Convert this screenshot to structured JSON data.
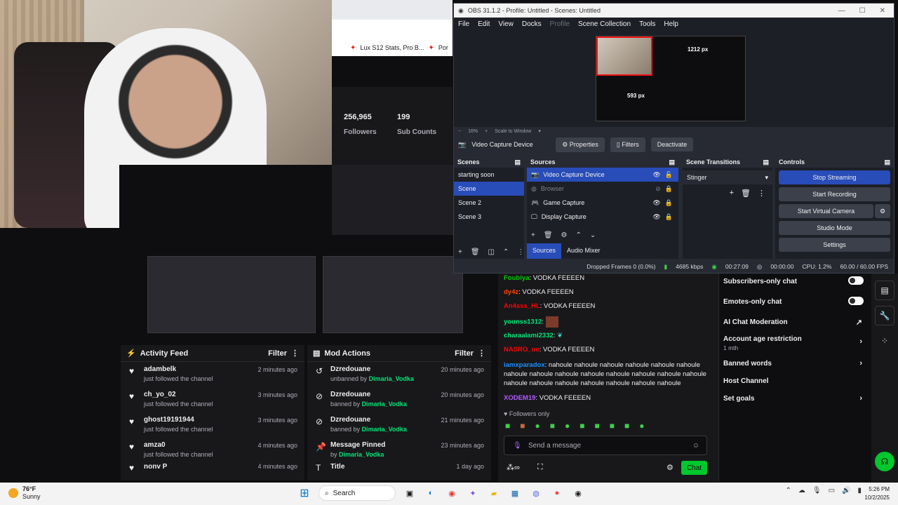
{
  "browser": {
    "bookmarks": [
      {
        "label": "Lux S12 Stats, Pro B..."
      },
      {
        "label": "Por"
      }
    ]
  },
  "stream_stats": {
    "followers_value": "256,965",
    "followers_label": "Followers",
    "subs_value": "199",
    "subs_label": "Sub Counts"
  },
  "obs": {
    "title": "OBS 31.1.2 - Profile: Untitled - Scenes: Untitled",
    "menu": [
      "File",
      "Edit",
      "View",
      "Docks",
      "Profile",
      "Scene Collection",
      "Tools",
      "Help"
    ],
    "preview_width_label": "1212 px",
    "preview_height_label": "593 px",
    "zoom": "16%",
    "scale_mode": "Scale to Window",
    "selected_source": "Video Capture Device",
    "properties_label": "Properties",
    "filters_label": "Filters",
    "deactivate_label": "Deactivate",
    "scenes_title": "Scenes",
    "scenes": [
      "starting soon",
      "Scene",
      "Scene 2",
      "Scene 3"
    ],
    "sources_title": "Sources",
    "sources": [
      "Video Capture Device",
      "Browser",
      "Game Capture",
      "Display Capture"
    ],
    "tab_sources": "Sources",
    "tab_audio_mixer": "Audio Mixer",
    "transitions_title": "Scene Transitions",
    "transition": "Stinger",
    "controls_title": "Controls",
    "controls": [
      "Stop Streaming",
      "Start Recording",
      "Start Virtual Camera",
      "Studio Mode",
      "Settings"
    ],
    "status": {
      "dropped": "Dropped Frames 0 (0.0%)",
      "bitrate": "4685 kbps",
      "live_time": "00:27:09",
      "rec_time": "00:00:00",
      "cpu": "CPU: 1.2%",
      "fps": "60.00 / 60.00 FPS"
    }
  },
  "activity_feed": {
    "title": "Activity Feed",
    "filter": "Filter",
    "items": [
      {
        "name": "adambelk",
        "sub": "just followed the channel",
        "time": "2 minutes ago"
      },
      {
        "name": "ch_yo_02",
        "sub": "just followed the channel",
        "time": "3 minutes ago"
      },
      {
        "name": "ghost19191944",
        "sub": "just followed the channel",
        "time": "3 minutes ago"
      },
      {
        "name": "amza0",
        "sub": "just followed the channel",
        "time": "4 minutes ago"
      },
      {
        "name": "nonv P",
        "sub": "",
        "time": "4 minutes ago"
      }
    ]
  },
  "mod_actions": {
    "title": "Mod Actions",
    "filter": "Filter",
    "items": [
      {
        "name": "Dzredouane",
        "action": "unbanned by",
        "by": "Dimaria_Vodka",
        "time": "20 minutes ago"
      },
      {
        "name": "Dzredouane",
        "action": "banned by",
        "by": "Dimaria_Vodka",
        "time": "20 minutes ago"
      },
      {
        "name": "Dzredouane",
        "action": "banned by",
        "by": "Dimaria_Vodka",
        "time": "21 minutes ago"
      },
      {
        "name": "Message Pinned",
        "action": "by",
        "by": "Dimaria_Vodka",
        "time": "23 minutes ago"
      },
      {
        "name": "Title",
        "action": "",
        "by": "",
        "time": "1 day ago"
      }
    ]
  },
  "chat": {
    "messages": [
      {
        "user": "Foubiya",
        "color": "#00c800",
        "text": "VODKA FEEEEN"
      },
      {
        "user": "dy4z",
        "color": "#ff4500",
        "text": "VODKA FEEEEN"
      },
      {
        "user": "An4sss_HL",
        "color": "#ff0000",
        "text": "VODKA FEEEEN"
      },
      {
        "user": "younss1312",
        "color": "#00e676",
        "text": ""
      },
      {
        "user": "charaalami2332",
        "color": "#00e676",
        "text": ""
      },
      {
        "user": "NASRO_ue",
        "color": "#ff0000",
        "text": "VODKA FEEEEN"
      },
      {
        "user": "iamxparadox",
        "color": "#1e90ff",
        "text": "nahoule nahoule nahoule nahoule nahoule nahoule nahoule nahoule nahoule nahoule nahoule nahoule nahoule nahoule nahoule nahoule nahoule nahoule nahoule nahoule nahoule"
      },
      {
        "user": "XODEM19",
        "color": "#b05bff",
        "text": "VODKA FEEEEN"
      }
    ],
    "followers_only": "Followers only",
    "placeholder": "Send a message",
    "chat_button": "Chat"
  },
  "mod_settings": {
    "subscribers_only": "Subscribers-only chat",
    "emotes_only": "Emotes-only chat",
    "ai_moderation": "AI Chat Moderation",
    "age_restriction": "Account age restriction",
    "age_value": "1 mth",
    "banned_words": "Banned words",
    "host_channel": "Host Channel",
    "set_goals": "Set goals"
  },
  "taskbar": {
    "temp": "76°F",
    "weather": "Sunny",
    "search": "Search",
    "time": "5:26 PM",
    "date": "10/2/2025"
  },
  "colors": {
    "twitch_green": "#00c82d",
    "obs_blue": "#284cb8",
    "mod_green": "#00e676"
  }
}
